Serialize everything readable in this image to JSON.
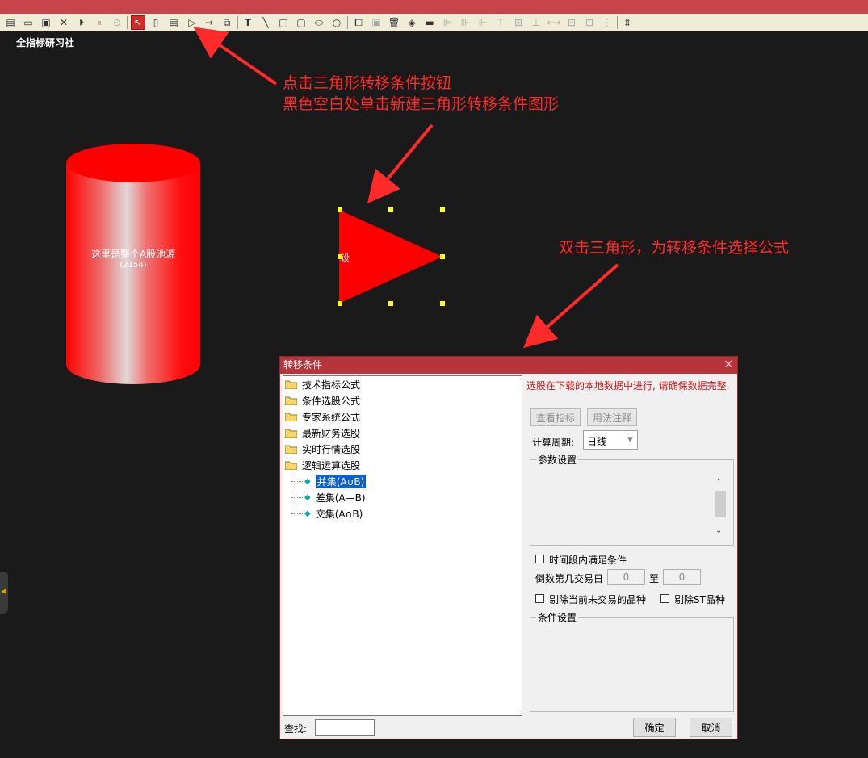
{
  "app": {
    "brand": "全指标研习社"
  },
  "toolbar": {
    "icons": [
      "new-icon",
      "open-icon",
      "save-icon",
      "delete-icon",
      "run-icon",
      "pause-icon",
      "stop-icon",
      "select-tool-icon",
      "pool-shape-icon",
      "list-shape-icon",
      "triangle-condition-icon",
      "arrow-tool-icon",
      "copy-shape-icon",
      "text-tool-icon",
      "line-tool-icon",
      "rect-tool-icon",
      "round-rect-tool-icon",
      "ellipse-tool-icon",
      "circle-tool-icon",
      "copy-icon",
      "paste-icon",
      "trash-icon",
      "fill-icon",
      "line-style-icon",
      "align-left-icon",
      "align-center-icon",
      "align-right-icon",
      "align-top-icon",
      "align-middle-icon",
      "align-bottom-icon",
      "same-width-icon",
      "same-height-icon",
      "distribute-icon",
      "grid-icon"
    ]
  },
  "callouts": {
    "c1_line1": "点击三角形转移条件按钮",
    "c1_line2": "黑色空白处单击新建三角形转移条件图形",
    "c2": "双击三角形，为转移条件选择公式"
  },
  "canvas": {
    "pool_label": "这里是整个A股池源",
    "pool_count": "(2154)",
    "triangle_label": "设",
    "colors": {
      "shape_red": "#ff0000",
      "handle": "#ffff00",
      "callout": "#ff2a2a"
    }
  },
  "dialog": {
    "title": "转移条件",
    "close": "✕",
    "tree": {
      "folders": [
        "技术指标公式",
        "条件选股公式",
        "专家系统公式",
        "最新财务选股",
        "实时行情选股",
        "逻辑运算选股"
      ],
      "leaves": [
        "并集(A∪B)",
        "差集(A—B)",
        "交集(A∩B)"
      ],
      "selected": "并集(A∪B)"
    },
    "warning": "选股在下载的本地数据中进行, 请确保数据完整.",
    "buttons": {
      "view_indicator": "查看指标",
      "usage_notes": "用法注释",
      "ok": "确定",
      "cancel": "取消"
    },
    "period_label": "计算周期:",
    "period_value": "日线",
    "params_group": "参数设置",
    "time_range_check": "时间段内满足条件",
    "countdown_label": "倒数第几交易日",
    "from_value": "0",
    "to_label": "至",
    "to_value": "0",
    "exclude_untraded": "剔除当前未交易的品种",
    "exclude_st": "剔除ST品种",
    "conditions_group": "条件设置",
    "search_label": "查找:",
    "search_value": ""
  }
}
